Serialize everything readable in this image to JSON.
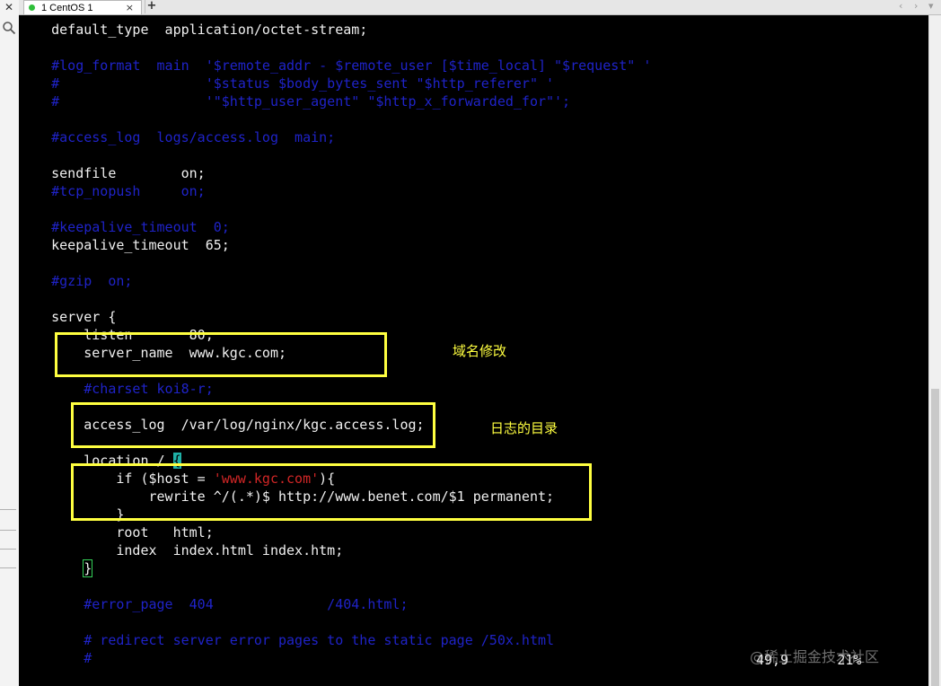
{
  "window": {
    "tab_label": "1 CentOS 1",
    "tab_close": "×",
    "tab_add": "+",
    "nav_left": "‹",
    "nav_right": "›",
    "nav_menu": "▾"
  },
  "colors": {
    "terminal_bg": "#000000",
    "text": "#f0f0f0",
    "comment": "#1f23c8",
    "string": "#d02626",
    "annotation": "#ffff40",
    "tab_status_dot": "#2fbf3a"
  },
  "icons": {
    "close": "close-icon",
    "search": "search-icon",
    "add_tab": "plus-icon"
  },
  "editor": {
    "lines": {
      "l1": "    default_type  application/octet-stream;",
      "l3": "    #log_format  main  '$remote_addr - $remote_user [$time_local] \"$request\" '",
      "l4": "    #                  '$status $body_bytes_sent \"$http_referer\" '",
      "l5": "    #                  '\"$http_user_agent\" \"$http_x_forwarded_for\"';",
      "l7": "    #access_log  logs/access.log  main;",
      "l9": "    sendfile        on;",
      "l10": "    #tcp_nopush     on;",
      "l12": "    #keepalive_timeout  0;",
      "l13": "    keepalive_timeout  65;",
      "l15": "    #gzip  on;",
      "l17": "    server {",
      "l18": "        listen       80;",
      "l19": "        server_name  www.kgc.com;",
      "l21": "        #charset koi8-r;",
      "l23": "        access_log  /var/log/nginx/kgc.access.log;",
      "l25a": "        location / ",
      "l25b": "{",
      "l26a": "            if ($host = ",
      "l26b": "'www.kgc.com'",
      "l26c": "){",
      "l27": "                rewrite ^/(.*)$ http://www.benet.com/$1 permanent;",
      "l28": "            }",
      "l29": "            root   html;",
      "l30": "            index  index.html index.htm;",
      "l31a": "        ",
      "l31b": "}",
      "l33": "        #error_page  404              /404.html;",
      "l35": "        # redirect server error pages to the static page /50x.html",
      "l36": "        #"
    },
    "status_position": "49,9",
    "status_percent": "21%"
  },
  "annotations": {
    "domain_change": "域名修改",
    "log_dir": "日志的目录"
  },
  "watermark": "@稀土掘金技术社区"
}
